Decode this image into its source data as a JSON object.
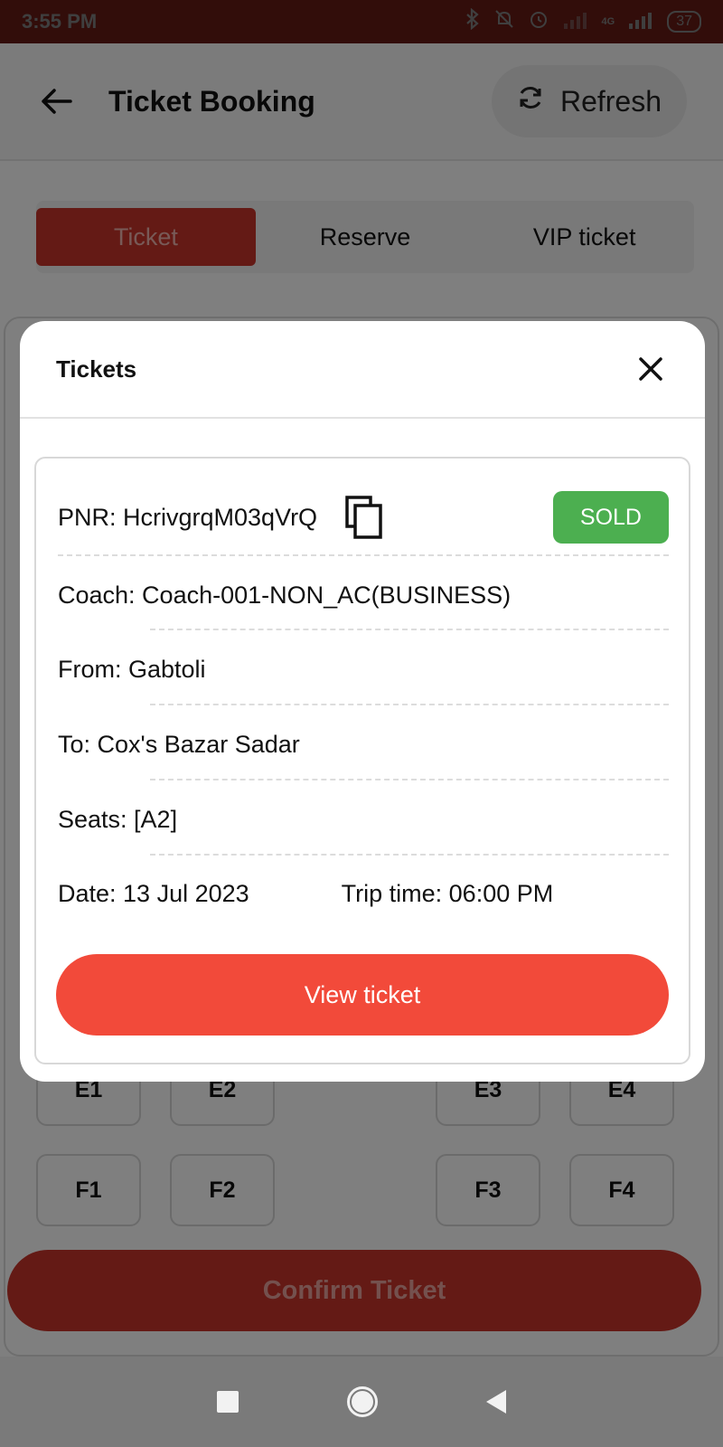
{
  "status_bar": {
    "time": "3:55 PM",
    "network_label": "4G",
    "battery": "37"
  },
  "app_bar": {
    "title": "Ticket Booking",
    "refresh_label": "Refresh"
  },
  "tabs": [
    {
      "label": "Ticket",
      "active": true
    },
    {
      "label": "Reserve",
      "active": false
    },
    {
      "label": "VIP ticket",
      "active": false
    }
  ],
  "seats": {
    "row_e": [
      "E1",
      "E2",
      "E3",
      "E4"
    ],
    "row_f": [
      "F1",
      "F2",
      "F3",
      "F4"
    ]
  },
  "confirm_label": "Confirm Ticket",
  "dialog": {
    "title": "Tickets",
    "pnr": "PNR: HcrivgrqM03qVrQ",
    "status": "SOLD",
    "coach": "Coach: Coach-001-NON_AC(BUSINESS)",
    "from": "From: Gabtoli",
    "to": "To: Cox's Bazar Sadar",
    "seats": "Seats: [A2]",
    "date": "Date: 13 Jul 2023",
    "trip_time": "Trip time: 06:00 PM",
    "view_label": "View ticket"
  },
  "colors": {
    "brand_red": "#c8342b",
    "button_red": "#f24a3a",
    "sold_green": "#4caf50"
  }
}
